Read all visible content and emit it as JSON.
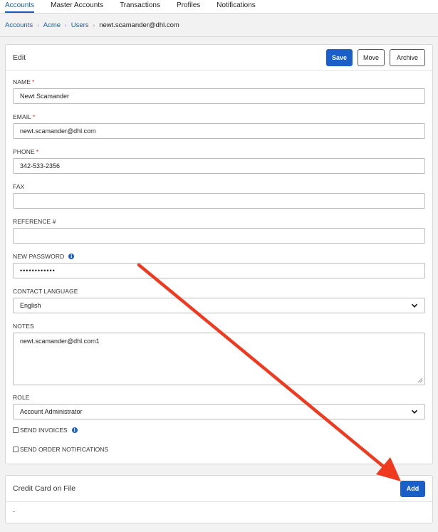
{
  "topnav": {
    "tabs": [
      {
        "label": "Accounts",
        "active": true
      },
      {
        "label": "Master Accounts",
        "active": false
      },
      {
        "label": "Transactions",
        "active": false
      },
      {
        "label": "Profiles",
        "active": false
      },
      {
        "label": "Notifications",
        "active": false
      }
    ]
  },
  "breadcrumb": {
    "items": [
      "Accounts",
      "Acme",
      "Users"
    ],
    "current": "newt.scamander@dhl.com"
  },
  "edit_panel": {
    "title": "Edit",
    "save_label": "Save",
    "move_label": "Move",
    "archive_label": "Archive",
    "fields": {
      "name": {
        "label": "NAME",
        "required_mark": "*",
        "value": "Newt Scamander"
      },
      "email": {
        "label": "EMAIL",
        "required_mark": "*",
        "value": "newt.scamander@dhl.com"
      },
      "phone": {
        "label": "PHONE",
        "required_mark": "*",
        "value": "342-533-2356"
      },
      "fax": {
        "label": "FAX",
        "value": ""
      },
      "reference": {
        "label": "REFERENCE #",
        "value": ""
      },
      "password": {
        "label": "NEW PASSWORD",
        "value": "••••••••••••",
        "info_icon": "info-icon"
      },
      "language": {
        "label": "CONTACT LANGUAGE",
        "value": "English"
      },
      "notes": {
        "label": "NOTES",
        "value": "newt.scamander@dhl.com1"
      },
      "role": {
        "label": "ROLE",
        "value": "Account Administrator"
      }
    },
    "checkboxes": {
      "send_invoices": {
        "label": "SEND INVOICES",
        "checked": false
      },
      "send_order_notifications": {
        "label": "SEND ORDER NOTIFICATIONS",
        "checked": false
      }
    }
  },
  "credit_card_panel": {
    "title": "Credit Card on File",
    "add_label": "Add",
    "value": "-"
  },
  "annotation": {
    "icon": "red-arrow",
    "color": "#f03a1f"
  },
  "colors": {
    "accent": "#1a5fc7",
    "required": "#dd2222"
  }
}
